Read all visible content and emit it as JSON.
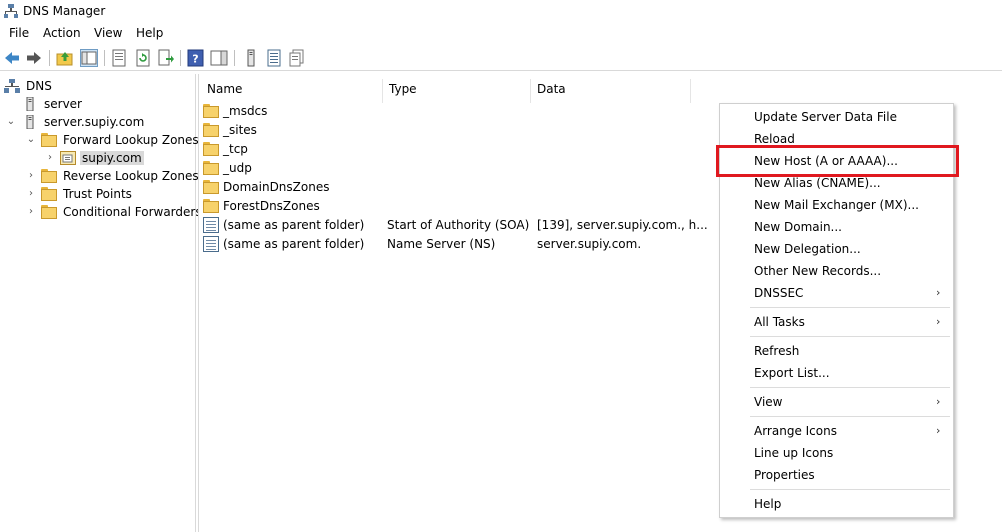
{
  "window": {
    "title": "DNS Manager"
  },
  "menu": [
    "File",
    "Action",
    "View",
    "Help"
  ],
  "tree": {
    "root": "DNS",
    "items": [
      {
        "label": "server"
      },
      {
        "label": "server.supiy.com"
      },
      {
        "label": "Forward Lookup Zones"
      },
      {
        "label": "supiy.com"
      },
      {
        "label": "Reverse Lookup Zones"
      },
      {
        "label": "Trust Points"
      },
      {
        "label": "Conditional Forwarders"
      }
    ]
  },
  "list": {
    "columns": [
      "Name",
      "Type",
      "Data"
    ],
    "rows": [
      {
        "icon": "folder-icon",
        "name": "_msdcs",
        "type": "",
        "data": ""
      },
      {
        "icon": "folder-icon",
        "name": "_sites",
        "type": "",
        "data": ""
      },
      {
        "icon": "folder-icon",
        "name": "_tcp",
        "type": "",
        "data": ""
      },
      {
        "icon": "folder-icon",
        "name": "_udp",
        "type": "",
        "data": ""
      },
      {
        "icon": "folder-icon",
        "name": "DomainDnsZones",
        "type": "",
        "data": ""
      },
      {
        "icon": "folder-icon",
        "name": "ForestDnsZones",
        "type": "",
        "data": ""
      },
      {
        "icon": "record-icon",
        "name": "(same as parent folder)",
        "type": "Start of Authority (SOA)",
        "data": "[139], server.supiy.com., h..."
      },
      {
        "icon": "record-icon",
        "name": "(same as parent folder)",
        "type": "Name Server (NS)",
        "data": "server.supiy.com."
      }
    ]
  },
  "context_menu": {
    "items": [
      {
        "label": "Update Server Data File",
        "submenu": false
      },
      {
        "label": "Reload",
        "submenu": false
      },
      {
        "label": "New Host (A or AAAA)...",
        "submenu": false,
        "highlighted": true
      },
      {
        "label": "New Alias (CNAME)...",
        "submenu": false
      },
      {
        "label": "New Mail Exchanger (MX)...",
        "submenu": false
      },
      {
        "label": "New Domain...",
        "submenu": false
      },
      {
        "label": "New Delegation...",
        "submenu": false
      },
      {
        "label": "Other New Records...",
        "submenu": false
      },
      {
        "label": "DNSSEC",
        "submenu": true
      },
      {
        "label": "All Tasks",
        "submenu": true
      },
      {
        "label": "Refresh",
        "submenu": false
      },
      {
        "label": "Export List...",
        "submenu": false
      },
      {
        "label": "View",
        "submenu": true
      },
      {
        "label": "Arrange Icons",
        "submenu": true
      },
      {
        "label": "Line up Icons",
        "submenu": false
      },
      {
        "label": "Properties",
        "submenu": false
      },
      {
        "label": "Help",
        "submenu": false
      }
    ],
    "submenu_arrow": "›"
  },
  "colors": {
    "highlight_border": "#e0181f",
    "folder": "#f7d26b",
    "selection": "#d9d9d9"
  }
}
